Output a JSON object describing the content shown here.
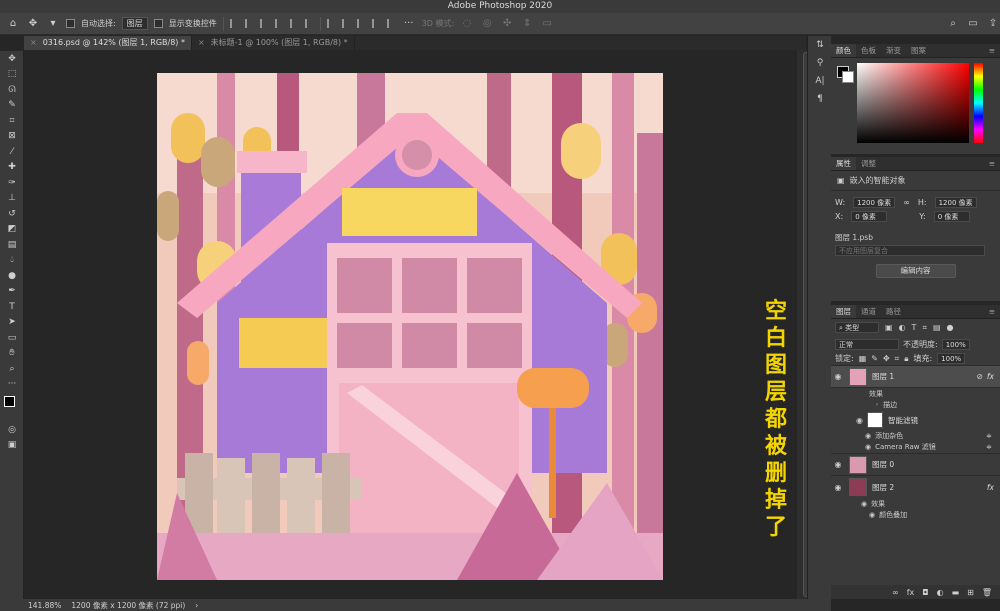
{
  "app_title": "Adobe Photoshop 2020",
  "options_bar": {
    "auto_select_label": "自动选择:",
    "auto_select_value": "图层",
    "show_transform_label": "显示变换控件",
    "mode_3d_label": "3D 模式:"
  },
  "tabs": [
    {
      "label": "0316.psd @ 142% (图层 1, RGB/8) *",
      "close": "×"
    },
    {
      "label": "未标题-1 @ 100% (图层 1, RGB/8) *",
      "close": "×"
    }
  ],
  "status": {
    "zoom": "141.88%",
    "doc_info": "1200 像素 x 1200 像素 (72 ppi)"
  },
  "overlay_text": "空白图层都被删掉了",
  "color_panel": {
    "tabs": [
      "颜色",
      "色板",
      "渐变",
      "图案"
    ]
  },
  "properties_panel": {
    "tabs": [
      "属性",
      "调整"
    ],
    "type": "嵌入的智能对象",
    "w_label": "W:",
    "w_value": "1200 像素",
    "h_label": "H:",
    "h_value": "1200 像素",
    "x_label": "X:",
    "x_value": "0 像素",
    "y_label": "Y:",
    "y_value": "0 像素",
    "linked_name": "图层 1.psb",
    "comp_placeholder": "不应用图层复合",
    "edit_button": "编辑内容"
  },
  "layers_panel": {
    "tabs": [
      "图层",
      "通道",
      "路径"
    ],
    "filter_label": "类型",
    "blend_mode": "正常",
    "opacity_label": "不透明度:",
    "opacity_value": "100%",
    "lock_label": "锁定:",
    "fill_label": "填充:",
    "fill_value": "100%",
    "layers": [
      {
        "name": "图层 1",
        "fx": "fx",
        "effects_label": "效果",
        "effects": [
          "描边"
        ],
        "smart_filter_label": "智能滤镜",
        "filters": [
          "添加杂色",
          "Camera Raw 滤镜"
        ]
      },
      {
        "name": "图层 0"
      },
      {
        "name": "图层 2",
        "fx": "fx",
        "effects_label": "效果",
        "effects": [
          "颜色叠加"
        ]
      }
    ]
  }
}
